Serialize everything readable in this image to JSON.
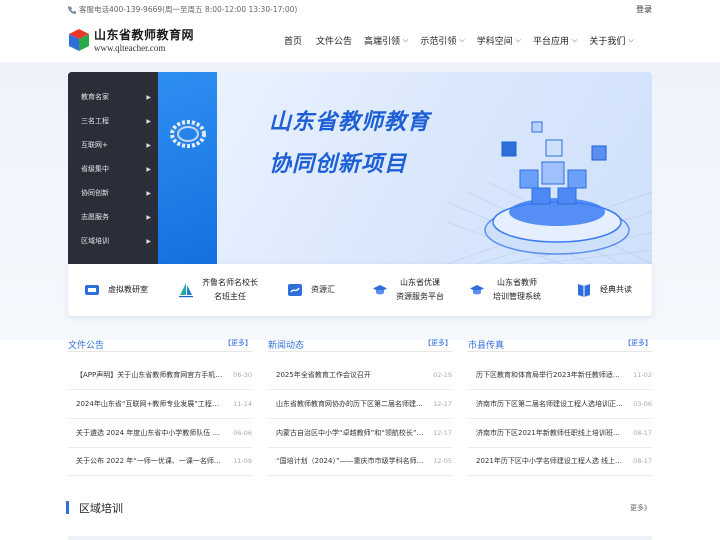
{
  "topbar": {
    "phone_text": "客服电话400-139-9669(周一至周五 8:00-12:00 13:30-17:00)",
    "login_label": "登录"
  },
  "logo": {
    "title": "山东省教师教育网",
    "url": "www.qlteacher.com"
  },
  "nav": {
    "items": [
      {
        "label": "首页",
        "dropdown": false
      },
      {
        "label": "文件公告",
        "dropdown": false
      },
      {
        "label": "高端引领",
        "dropdown": true
      },
      {
        "label": "示范引领",
        "dropdown": true
      },
      {
        "label": "学科空间",
        "dropdown": true
      },
      {
        "label": "平台应用",
        "dropdown": true
      },
      {
        "label": "关于我们",
        "dropdown": true
      }
    ]
  },
  "sidebar": {
    "items": [
      {
        "label": "教育名家"
      },
      {
        "label": "三名工程"
      },
      {
        "label": "互联网+"
      },
      {
        "label": "省级集中"
      },
      {
        "label": "协同创新"
      },
      {
        "label": "志愿服务"
      },
      {
        "label": "区域培训"
      }
    ]
  },
  "hero": {
    "line1": "山东省教师教育",
    "line2": "协同创新项目"
  },
  "services": [
    {
      "line1": "虚拟教研室",
      "line2": "",
      "icon": "virtual-lab-icon"
    },
    {
      "line1": "齐鲁名师名校长",
      "line2": "名班主任",
      "icon": "sail-icon"
    },
    {
      "line1": "资源汇",
      "line2": "",
      "icon": "resource-icon"
    },
    {
      "line1": "山东省优课",
      "line2": "资源服务平台",
      "icon": "graduation-cap-icon"
    },
    {
      "line1": "山东省教师",
      "line2": "培训管理系统",
      "icon": "graduation-cap-icon"
    },
    {
      "line1": "经典共读",
      "line2": "",
      "icon": "book-icon"
    }
  ],
  "columns": [
    {
      "title": "文件公告",
      "more": "【更多】",
      "rows": [
        {
          "title": "【APP声明】关于山东省教师教育网官方手机客...",
          "date": "06-30"
        },
        {
          "title": "2024年山东省“互联网+教师专业发展”工程市级...",
          "date": "11-14"
        },
        {
          "title": "关于遴选 2024 年度山东省中小学教师队伍 素...",
          "date": "06-06"
        },
        {
          "title": "关于公布 2022 年“一师一优课、一课一名师”活...",
          "date": "11-09"
        }
      ]
    },
    {
      "title": "新闻动态",
      "more": "【更多】",
      "rows": [
        {
          "title": "2025年全省教育工作会议召开",
          "date": "02-19"
        },
        {
          "title": "山东省教师教育网协办的历下区第二届名师建...",
          "date": "12-17"
        },
        {
          "title": "内蒙古自治区中小学“卓越教师”和“领航校长”培...",
          "date": "12-17"
        },
        {
          "title": "“国培计划（2024）”——重庆市市级学科名师...",
          "date": "12-05"
        }
      ]
    },
    {
      "title": "市县传真",
      "more": "【更多】",
      "rows": [
        {
          "title": "历下区教育和体育局举行2023年新任教师适应...",
          "date": "11-02"
        },
        {
          "title": "济南市历下区第二届名师建设工程人选培训正...",
          "date": "03-06"
        },
        {
          "title": "济南市历下区2021年新教师任职线上培训班顺...",
          "date": "08-17"
        },
        {
          "title": "2021年历下区中小学名师建设工程人选 线上培...",
          "date": "08-17"
        }
      ]
    }
  ],
  "region": {
    "title": "区域培训",
    "more": "更多》"
  },
  "colors": {
    "brand_blue": "#2f6fdc",
    "sidebar_dark": "#2a2e39",
    "hero_text": "#1d5fd6"
  }
}
